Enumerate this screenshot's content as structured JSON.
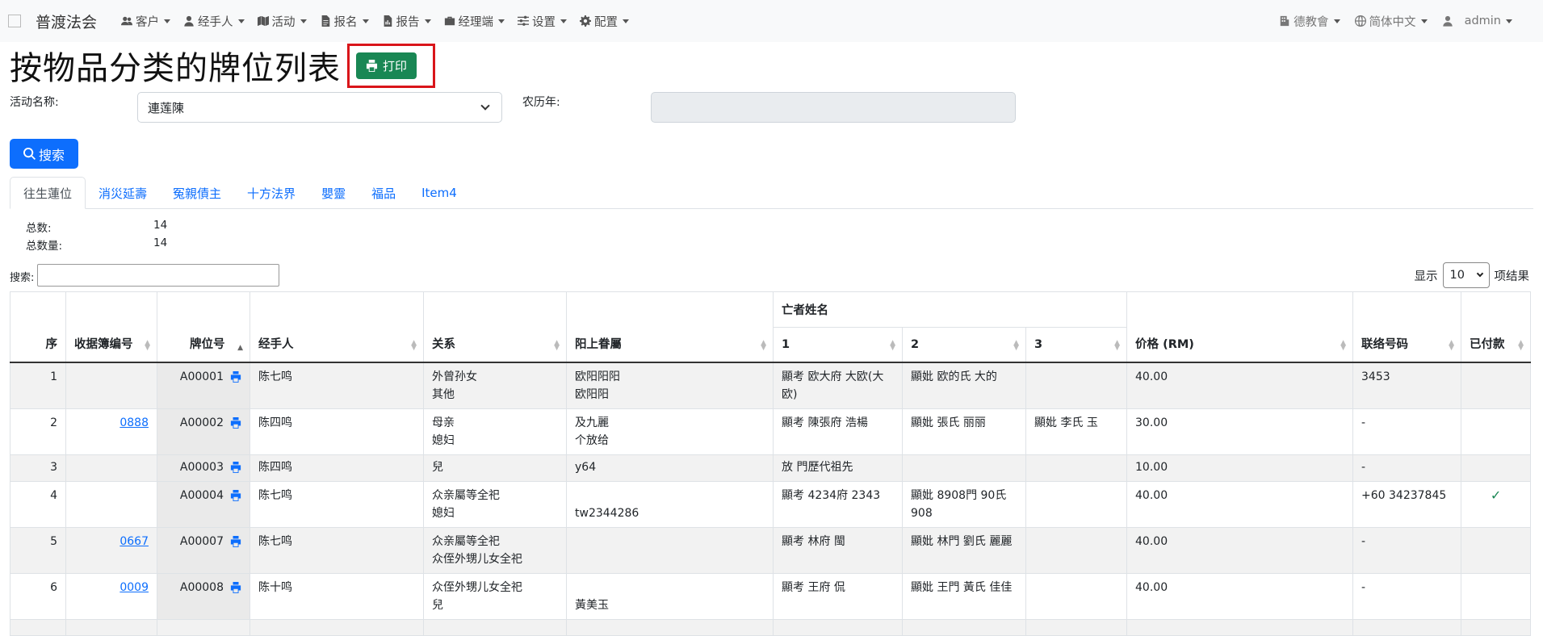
{
  "navbar": {
    "brand": "普渡法会",
    "items": [
      {
        "label": "客户",
        "icon": "users-icon"
      },
      {
        "label": "经手人",
        "icon": "user-icon"
      },
      {
        "label": "活动",
        "icon": "map-icon"
      },
      {
        "label": "报名",
        "icon": "file-icon"
      },
      {
        "label": "报告",
        "icon": "file-chart-icon"
      },
      {
        "label": "经理端",
        "icon": "briefcase-icon"
      },
      {
        "label": "设置",
        "icon": "sliders-icon"
      },
      {
        "label": "配置",
        "icon": "gear-icon"
      }
    ],
    "right": {
      "org": "德教會",
      "language": "简体中文",
      "user": "admin"
    }
  },
  "page": {
    "title": "按物品分类的牌位列表",
    "print_label": "打印"
  },
  "filters": {
    "event_label": "活动名称:",
    "event_value": "連莲陳",
    "lunar_label": "农历年:",
    "lunar_value": "",
    "search_button": "搜索"
  },
  "tabs": [
    "往生蓮位",
    "消災延壽",
    "冤親債主",
    "十方法界",
    "嬰靈",
    "福品",
    "Item4"
  ],
  "stats": {
    "total_label": "总数:",
    "total_value": "14",
    "qty_label": "总数量:",
    "qty_value": "14"
  },
  "table_controls": {
    "search_label": "搜索:",
    "search_value": "",
    "show_label": "显示",
    "page_length": "10",
    "results_label": "项结果"
  },
  "table": {
    "columns": {
      "seq": "序",
      "receipt": "收据簿编号",
      "plate": "牌位号",
      "handler": "经手人",
      "relation": "关系",
      "residence": "阳上眷屬",
      "deceased_group": "亡者姓名",
      "d1": "1",
      "d2": "2",
      "d3": "3",
      "price": "价格 (RM)",
      "contact": "联络号码",
      "paid": "已付款"
    },
    "rows": [
      {
        "seq": "1",
        "receipt": "",
        "plate": "A00001",
        "handler": "陈七鸣",
        "relation1": "外曾孙女",
        "relation2": "其他",
        "res1": "欧阳阳阳",
        "res2": "欧阳阳",
        "d1": "顯考 欧大府 大欧(大欧)",
        "d2": "顯妣 欧的氏 大的",
        "d3": "",
        "price": "40.00",
        "contact": "3453",
        "paid": ""
      },
      {
        "seq": "2",
        "receipt": "0888",
        "plate": "A00002",
        "handler": "陈四鸣",
        "relation1": "母亲",
        "relation2": "媳妇",
        "res1": "及九麗",
        "res2": "个放给",
        "d1": "顯考 陳張府 浩楊",
        "d2": "顯妣 張氏 丽丽",
        "d3": "顯妣 李氏 玉",
        "price": "30.00",
        "contact": "-",
        "paid": ""
      },
      {
        "seq": "3",
        "receipt": "",
        "plate": "A00003",
        "handler": "陈四鸣",
        "relation1": "兒",
        "relation2": "",
        "res1": "y64",
        "res2": "",
        "d1": "放 門歷代祖先",
        "d2": "",
        "d3": "",
        "price": "10.00",
        "contact": "-",
        "paid": ""
      },
      {
        "seq": "4",
        "receipt": "",
        "plate": "A00004",
        "handler": "陈七鸣",
        "relation1": "众亲屬等全祀",
        "relation2": "媳妇",
        "res1": "",
        "res2": "tw2344286",
        "d1": "顯考 4234府 2343",
        "d2": "顯妣 8908門 90氏 908",
        "d3": "",
        "price": "40.00",
        "contact": "+60 34237845",
        "paid": "✓"
      },
      {
        "seq": "5",
        "receipt": "0667",
        "plate": "A00007",
        "handler": "陈七鸣",
        "relation1": "众亲屬等全祀",
        "relation2": "众侄外甥儿女全祀",
        "res1": "",
        "res2": "",
        "d1": "顯考 林府 閩",
        "d2": "顯妣 林門 劉氏 麗麗",
        "d3": "",
        "price": "40.00",
        "contact": "-",
        "paid": ""
      },
      {
        "seq": "6",
        "receipt": "0009",
        "plate": "A00008",
        "handler": "陈十鸣",
        "relation1": "众侄外甥儿女全祀",
        "relation2": "兒",
        "res1": "",
        "res2": "黃美玉",
        "d1": "顯考 王府 侃",
        "d2": "顯妣 王門 黃氏 佳佳",
        "d3": "",
        "price": "40.00",
        "contact": "-",
        "paid": ""
      }
    ]
  }
}
